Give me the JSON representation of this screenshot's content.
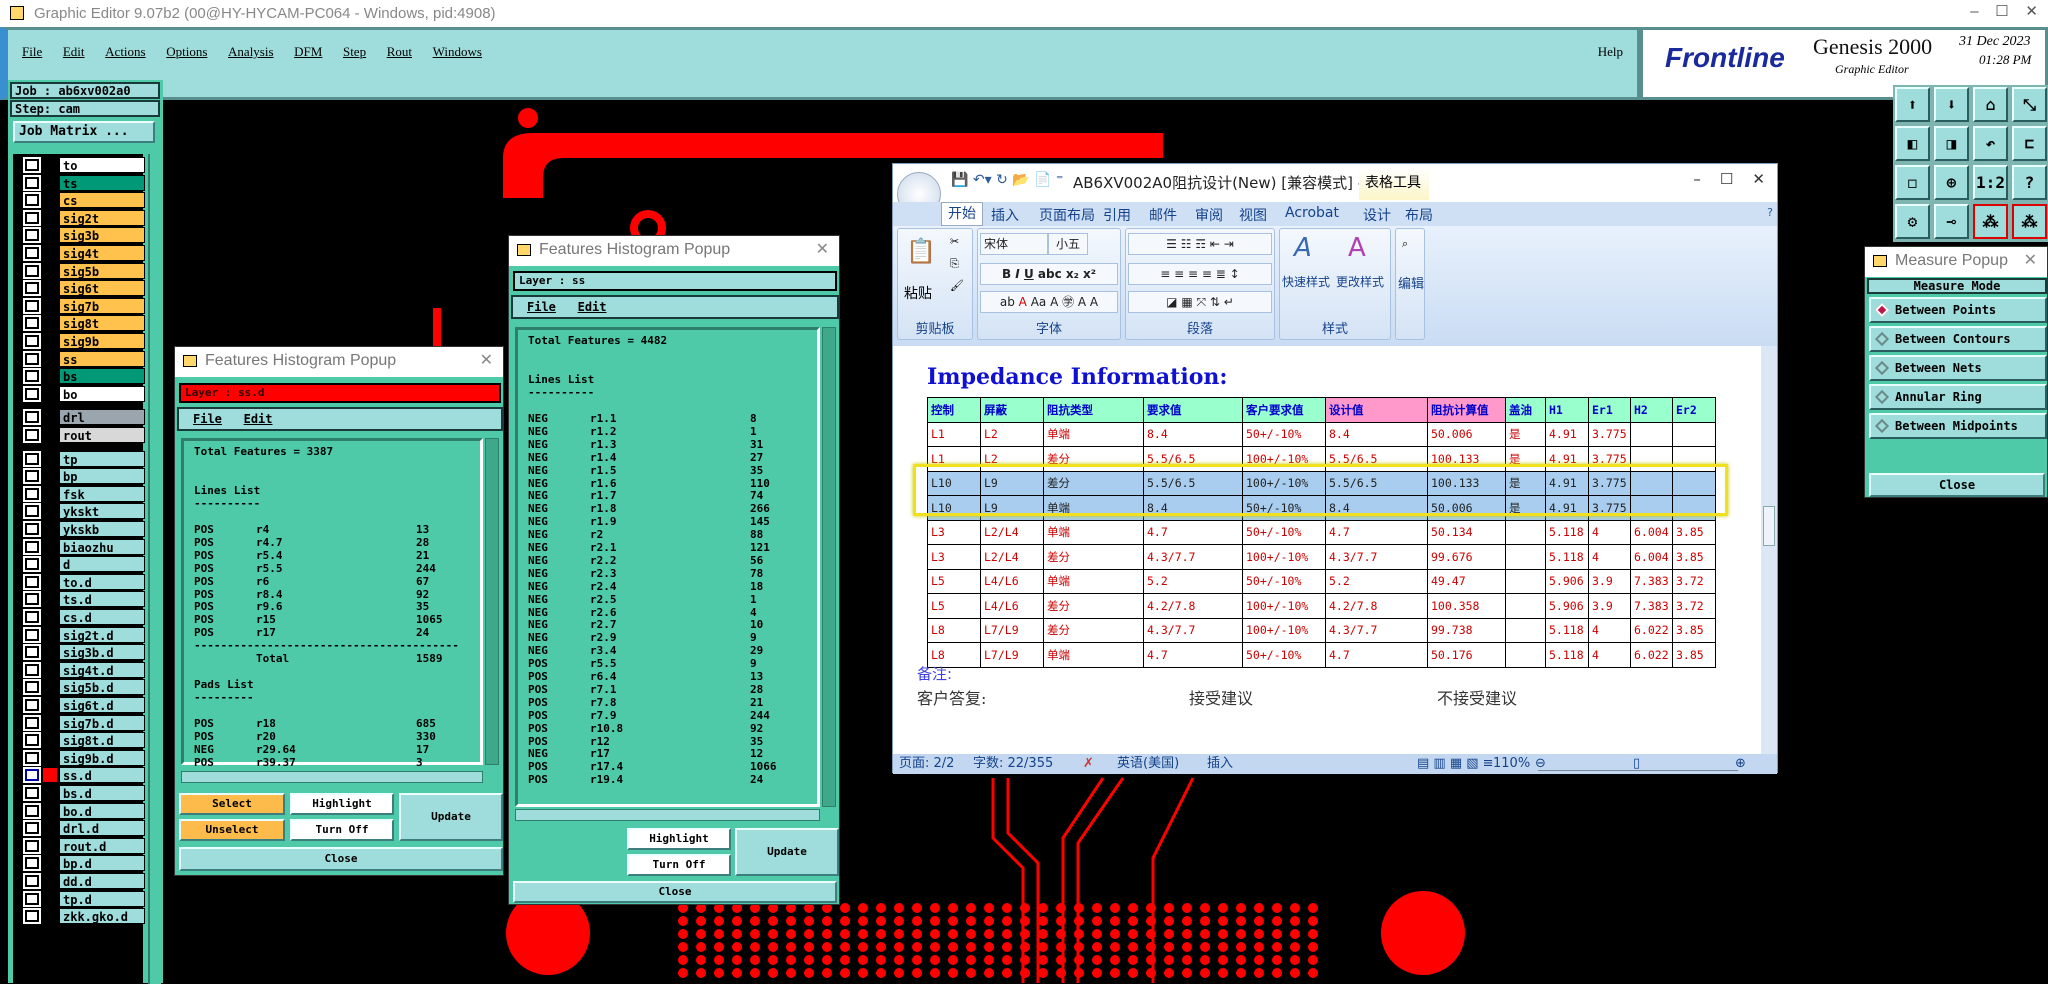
{
  "window": {
    "title": "Graphic Editor 9.07b2 (00@HY-HYCAM-PC064 - Windows, pid:4908)"
  },
  "menu": {
    "items": [
      "File",
      "Edit",
      "Actions",
      "Options",
      "Analysis",
      "DFM",
      "Step",
      "Rout",
      "Windows"
    ],
    "help": "Help"
  },
  "brand": {
    "logo": "Frontline",
    "product": "Genesis 2000",
    "subtitle": "Graphic Editor",
    "date": "31 Dec 2023",
    "time": "01:28 PM"
  },
  "job": {
    "job_label": "Job : ab6xv002a0",
    "step_label": "Step: cam",
    "matrix_button": "Job Matrix ..."
  },
  "layers": {
    "board": [
      {
        "name": "to",
        "color": "#ffffff"
      },
      {
        "name": "ts",
        "color": "#009977"
      },
      {
        "name": "cs",
        "color": "#ffc34d"
      },
      {
        "name": "sig2t",
        "color": "#ffc34d"
      },
      {
        "name": "sig3b",
        "color": "#ffc34d"
      },
      {
        "name": "sig4t",
        "color": "#ffc34d"
      },
      {
        "name": "sig5b",
        "color": "#ffc34d"
      },
      {
        "name": "sig6t",
        "color": "#ffc34d"
      },
      {
        "name": "sig7b",
        "color": "#ffc34d"
      },
      {
        "name": "sig8t",
        "color": "#ffc34d"
      },
      {
        "name": "sig9b",
        "color": "#ffc34d"
      },
      {
        "name": "ss",
        "color": "#ffc34d"
      },
      {
        "name": "bs",
        "color": "#009977"
      },
      {
        "name": "bo",
        "color": "#ffffff"
      }
    ],
    "drill": [
      {
        "name": "drl",
        "color": "#9aa5ad"
      },
      {
        "name": "rout",
        "color": "#d8d8d8"
      }
    ],
    "misc": [
      "tp",
      "bp",
      "fsk",
      "ykskt",
      "ykskb",
      "biaozhu",
      "d",
      "to.d",
      "ts.d",
      "cs.d",
      "sig2t.d",
      "sig3b.d",
      "sig4t.d",
      "sig5b.d",
      "sig6t.d",
      "sig7b.d",
      "sig8t.d",
      "sig9b.d",
      "ss.d",
      "bs.d",
      "bo.d",
      "drl.d",
      "rout.d",
      "bp.d",
      "dd.d",
      "tp.d",
      "zkk.gko.d"
    ],
    "active": "ss.d",
    "work_color": "#ff0000"
  },
  "hist1": {
    "title": "Features Histogram Popup",
    "layer": "Layer :  ss.d",
    "menu": [
      "File",
      "Edit"
    ],
    "total": "Total Features = 3387",
    "lines_header": "Lines List",
    "lines_rule": "----------",
    "lines": [
      [
        "POS",
        "r4",
        "13"
      ],
      [
        "POS",
        "r4.7",
        "28"
      ],
      [
        "POS",
        "r5.4",
        "21"
      ],
      [
        "POS",
        "r5.5",
        "244"
      ],
      [
        "POS",
        "r6",
        "67"
      ],
      [
        "POS",
        "r8.4",
        "92"
      ],
      [
        "POS",
        "r9.6",
        "35"
      ],
      [
        "POS",
        "r15",
        "1065"
      ],
      [
        "POS",
        "r17",
        "24"
      ]
    ],
    "rule": "----------------------------------------",
    "total_label": "Total",
    "total_value": "1589",
    "pads_header": "Pads List",
    "pads_rule": "---------",
    "pads": [
      [
        "POS",
        "r18",
        "685"
      ],
      [
        "POS",
        "r20",
        "330"
      ],
      [
        "NEG",
        "r29.64",
        "17"
      ],
      [
        "POS",
        "r39.37",
        "3"
      ]
    ],
    "buttons": {
      "select": "Select",
      "unselect": "Unselect",
      "highlight": "Highlight",
      "turn_off": "Turn Off",
      "update": "Update",
      "close": "Close"
    }
  },
  "hist2": {
    "title": "Features Histogram Popup",
    "layer": "Layer :  ss",
    "menu": [
      "File",
      "Edit"
    ],
    "total": "Total Features = 4482",
    "lines_header": "Lines List",
    "lines_rule": "----------",
    "lines": [
      [
        "NEG",
        "r1.1",
        "8"
      ],
      [
        "NEG",
        "r1.2",
        "1"
      ],
      [
        "NEG",
        "r1.3",
        "31"
      ],
      [
        "NEG",
        "r1.4",
        "27"
      ],
      [
        "NEG",
        "r1.5",
        "35"
      ],
      [
        "NEG",
        "r1.6",
        "110"
      ],
      [
        "NEG",
        "r1.7",
        "74"
      ],
      [
        "NEG",
        "r1.8",
        "266"
      ],
      [
        "NEG",
        "r1.9",
        "145"
      ],
      [
        "NEG",
        "r2",
        "88"
      ],
      [
        "NEG",
        "r2.1",
        "121"
      ],
      [
        "NEG",
        "r2.2",
        "56"
      ],
      [
        "NEG",
        "r2.3",
        "78"
      ],
      [
        "NEG",
        "r2.4",
        "18"
      ],
      [
        "NEG",
        "r2.5",
        "1"
      ],
      [
        "NEG",
        "r2.6",
        "4"
      ],
      [
        "NEG",
        "r2.7",
        "10"
      ],
      [
        "NEG",
        "r2.9",
        "9"
      ],
      [
        "NEG",
        "r3.4",
        "29"
      ],
      [
        "POS",
        "r5.5",
        "9"
      ],
      [
        "POS",
        "r6.4",
        "13"
      ],
      [
        "POS",
        "r7.1",
        "28"
      ],
      [
        "POS",
        "r7.8",
        "21"
      ],
      [
        "POS",
        "r7.9",
        "244"
      ],
      [
        "POS",
        "r10.8",
        "92"
      ],
      [
        "POS",
        "r12",
        "35"
      ],
      [
        "NEG",
        "r17",
        "12"
      ],
      [
        "POS",
        "r17.4",
        "1066"
      ],
      [
        "POS",
        "r19.4",
        "24"
      ]
    ],
    "buttons": {
      "highlight": "Highlight",
      "turn_off": "Turn Off",
      "update": "Update",
      "close": "Close"
    }
  },
  "word": {
    "title": "AB6XV002A0阻抗设计(New) [兼容模式] - Micr...",
    "context_tab": "表格工具",
    "tabs": [
      "开始",
      "插入",
      "页面布局",
      "引用",
      "邮件",
      "审阅",
      "视图",
      "Acrobat",
      "设计",
      "布局"
    ],
    "ribbon": {
      "clipboard": "剪贴板",
      "paste": "粘贴",
      "font_group": "字体",
      "font_name": "宋体",
      "font_size": "小五",
      "paragraph": "段落",
      "styles": "样式",
      "quick_styles": "快速样式",
      "change_styles": "更改样式",
      "editing": "编辑"
    },
    "doc": {
      "heading": "Impedance Information:",
      "columns": [
        "控制",
        "屏蔽",
        "阻抗类型",
        "要求值",
        "客户要求值",
        "设计值",
        "阻抗计算值",
        "盖油",
        "H1",
        "Er1",
        "H2",
        "Er2"
      ],
      "rows": [
        [
          "L1",
          "L2",
          "单端",
          "8.4",
          "50+/-10%",
          "8.4",
          "50.006",
          "是",
          "4.91",
          "3.775",
          "",
          ""
        ],
        [
          "L1",
          "L2",
          "差分",
          "5.5/6.5",
          "100+/-10%",
          "5.5/6.5",
          "100.133",
          "是",
          "4.91",
          "3.775",
          "",
          ""
        ],
        [
          "L10",
          "L9",
          "差分",
          "5.5/6.5",
          "100+/-10%",
          "5.5/6.5",
          "100.133",
          "是",
          "4.91",
          "3.775",
          "",
          ""
        ],
        [
          "L10",
          "L9",
          "单端",
          "8.4",
          "50+/-10%",
          "8.4",
          "50.006",
          "是",
          "4.91",
          "3.775",
          "",
          ""
        ],
        [
          "L3",
          "L2/L4",
          "单端",
          "4.7",
          "50+/-10%",
          "4.7",
          "50.134",
          "",
          "5.118",
          "4",
          "6.004",
          "3.85"
        ],
        [
          "L3",
          "L2/L4",
          "差分",
          "4.3/7.7",
          "100+/-10%",
          "4.3/7.7",
          "99.676",
          "",
          "5.118",
          "4",
          "6.004",
          "3.85"
        ],
        [
          "L5",
          "L4/L6",
          "单端",
          "5.2",
          "50+/-10%",
          "5.2",
          "49.47",
          "",
          "5.906",
          "3.9",
          "7.383",
          "3.72"
        ],
        [
          "L5",
          "L4/L6",
          "差分",
          "4.2/7.8",
          "100+/-10%",
          "4.2/7.8",
          "100.358",
          "",
          "5.906",
          "3.9",
          "7.383",
          "3.72"
        ],
        [
          "L8",
          "L7/L9",
          "差分",
          "4.3/7.7",
          "100+/-10%",
          "4.3/7.7",
          "99.738",
          "",
          "5.118",
          "4",
          "6.022",
          "3.85"
        ],
        [
          "L8",
          "L7/L9",
          "单端",
          "4.7",
          "50+/-10%",
          "4.7",
          "50.176",
          "",
          "5.118",
          "4",
          "6.022",
          "3.85"
        ]
      ],
      "selected_rows": [
        2,
        3
      ],
      "note": "备注:",
      "reply": "客户答复:",
      "accept": "接受建议",
      "reject": "不接受建议"
    },
    "status": {
      "page": "页面: 2/2",
      "words": "字数: 22/355",
      "language": "英语(美国)",
      "mode": "插入",
      "zoom": "110%"
    }
  },
  "measure": {
    "title": "Measure Popup",
    "mode_label": "Measure Mode",
    "options": [
      "Between Points",
      "Between Contours",
      "Between Nets",
      "Annular Ring",
      "Between Midpoints"
    ],
    "selected": 0,
    "close": "Close"
  },
  "toolbar_icons": [
    "view-top-icon",
    "view-bottom-icon",
    "home-icon",
    "zoom-area-icon",
    "pan-left-icon",
    "pan-right-icon",
    "undo-view-icon",
    "snap-icon",
    "zoom-fit-icon",
    "zoom-in-icon",
    "ratio-icon",
    "help-icon",
    "tools-icon",
    "probe-icon",
    "netlist-icon",
    "netlist2-icon"
  ]
}
